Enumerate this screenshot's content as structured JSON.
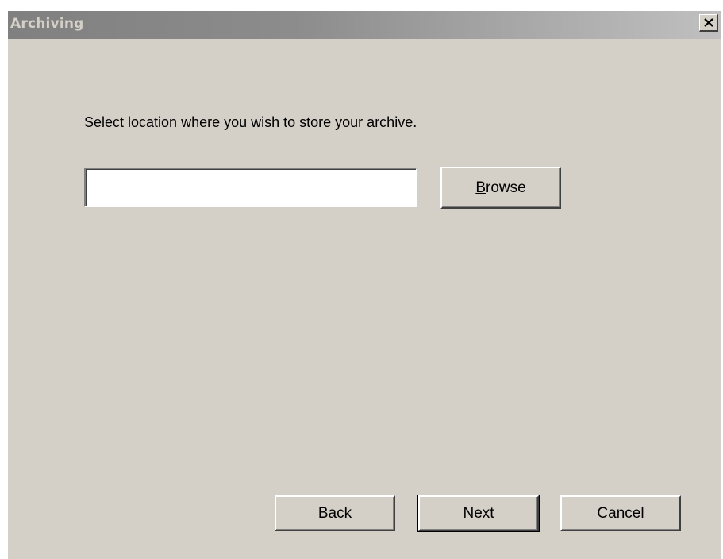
{
  "window": {
    "title": "Archiving",
    "close_icon": "close-icon"
  },
  "main": {
    "prompt": "Select location where you wish to store your archive.",
    "location_input": {
      "value": "",
      "placeholder": ""
    },
    "browse": {
      "accel": "B",
      "rest": "rowse"
    }
  },
  "footer": {
    "back": {
      "accel": "B",
      "rest": "ack"
    },
    "next": {
      "accel": "N",
      "rest": "ext"
    },
    "cancel": {
      "accel": "C",
      "rest": "ancel"
    }
  },
  "colors": {
    "face": "#d4d0c8",
    "title_gradient_start": "#808080",
    "title_gradient_end": "#c0c0c0"
  }
}
